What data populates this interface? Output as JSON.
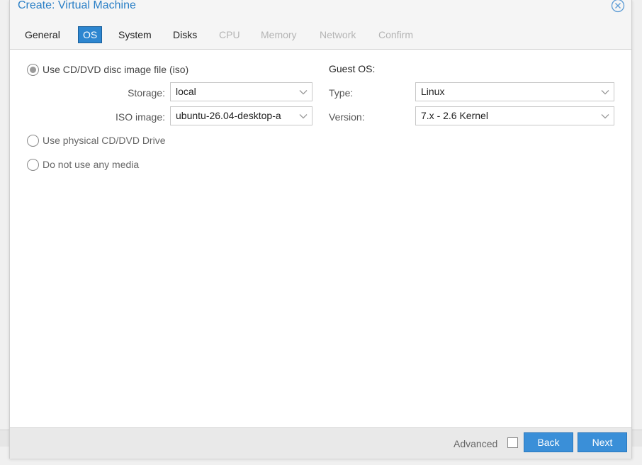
{
  "window": {
    "title": "Create: Virtual Machine"
  },
  "tabs": [
    {
      "label": "General",
      "state": "enabled"
    },
    {
      "label": "OS",
      "state": "active"
    },
    {
      "label": "System",
      "state": "enabled"
    },
    {
      "label": "Disks",
      "state": "enabled"
    },
    {
      "label": "CPU",
      "state": "disabled"
    },
    {
      "label": "Memory",
      "state": "disabled"
    },
    {
      "label": "Network",
      "state": "disabled"
    },
    {
      "label": "Confirm",
      "state": "disabled"
    }
  ],
  "media": {
    "option_iso": "Use CD/DVD disc image file (iso)",
    "storage_label": "Storage:",
    "storage_value": "local",
    "iso_label": "ISO image:",
    "iso_value": "ubuntu-26.04-desktop-a",
    "option_physical": "Use physical CD/DVD Drive",
    "option_none": "Do not use any media",
    "selected": "iso"
  },
  "guest_os": {
    "title": "Guest OS:",
    "type_label": "Type:",
    "type_value": "Linux",
    "version_label": "Version:",
    "version_value": "7.x - 2.6 Kernel"
  },
  "footer": {
    "advanced_label": "Advanced",
    "advanced_checked": false,
    "back_label": "Back",
    "next_label": "Next"
  },
  "colors": {
    "accent": "#2d86d0",
    "title": "#2a7fc6",
    "disabled_text": "#b4b4b4"
  }
}
